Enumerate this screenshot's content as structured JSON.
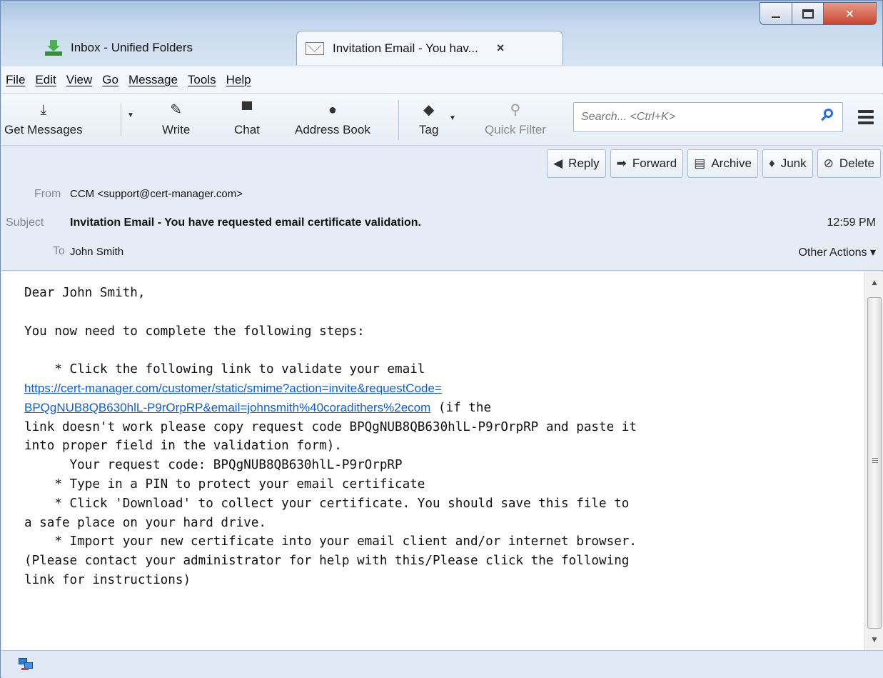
{
  "tabs": [
    {
      "label": "Inbox - Unified Folders",
      "icon": "inbox-download-icon"
    },
    {
      "label": "Invitation Email - You hav...",
      "icon": "mail-envelope-icon",
      "close": "×"
    }
  ],
  "menu": [
    "File",
    "Edit",
    "View",
    "Go",
    "Message",
    "Tools",
    "Help"
  ],
  "toolbar": {
    "get_messages": "Get Messages",
    "write": "Write",
    "chat": "Chat",
    "address_book": "Address Book",
    "tag": "Tag",
    "quick_filter": "Quick Filter",
    "search_placeholder": "Search... <Ctrl+K>"
  },
  "actions": {
    "reply": "Reply",
    "forward": "Forward",
    "archive": "Archive",
    "junk": "Junk",
    "delete": "Delete"
  },
  "header": {
    "from_label": "From",
    "from_value": "CCM <support@cert-manager.com>",
    "subject_label": "Subject",
    "subject_value": "Invitation Email - You have requested email certificate validation.",
    "time": "12:59 PM",
    "to_label": "To",
    "to_value": "John Smith",
    "other_actions": "Other Actions ▾"
  },
  "body": {
    "greeting": "Dear John Smith,",
    "intro": "You now need to complete the following steps:",
    "step1": "    * Click the following link to validate your email",
    "link_line1": "https://cert-manager.com/customer/static/smime?action=invite&requestCode=",
    "link_line2": "BPQgNUB8QB630hlL-P9rOrpRP&email=johnsmith%40coradithers%2ecom",
    "after_link": " (if the",
    "line_a": "link doesn't work please copy request code BPQgNUB8QB630hlL-P9rOrpRP and paste it",
    "line_b": "into proper field in the validation form).",
    "request_code": "      Your request code: BPQgNUB8QB630hlL-P9rOrpRP",
    "step2": "    * Type in a PIN to protect your email certificate",
    "step3a": "    * Click 'Download' to collect your certificate. You should save this file to",
    "step3b": "a safe place on your hard drive.",
    "step4a": "    * Import your new certificate into your email client and/or internet browser.",
    "step4b": "(Please contact your administrator for help with this/Please click the following",
    "step4c": "link for instructions)"
  }
}
